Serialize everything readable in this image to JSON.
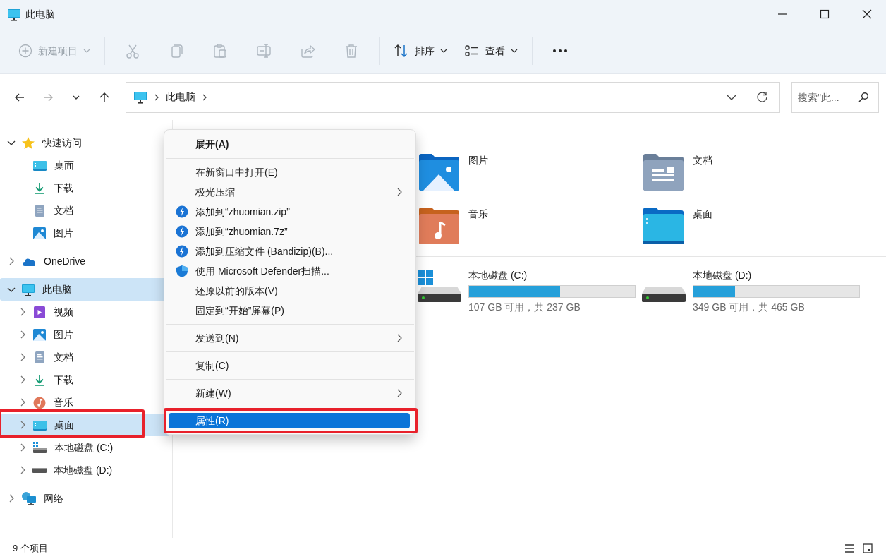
{
  "window": {
    "title": "此电脑"
  },
  "toolbar": {
    "new_button": {
      "label": "新建项目",
      "disabled": true
    },
    "actions": [
      {
        "kind": "cut",
        "disabled": true
      },
      {
        "kind": "copy",
        "disabled": true
      },
      {
        "kind": "paste",
        "disabled": true
      },
      {
        "kind": "rename",
        "disabled": true
      },
      {
        "kind": "share",
        "disabled": true
      },
      {
        "kind": "delete",
        "disabled": true
      }
    ],
    "sort": {
      "label": "排序"
    },
    "view": {
      "label": "查看"
    }
  },
  "address": {
    "path": [
      "此电脑"
    ],
    "search": {
      "placeholder": "搜索\"此..."
    }
  },
  "sidebar": {
    "items": [
      {
        "label": "快速访问",
        "kind": "star",
        "expanded": true,
        "selected": false,
        "children": [
          {
            "label": "桌面",
            "kind": "desktop",
            "selected": false
          },
          {
            "label": "下载",
            "kind": "download",
            "selected": false
          },
          {
            "label": "文档",
            "kind": "documents",
            "selected": false
          },
          {
            "label": "图片",
            "kind": "pictures",
            "selected": false
          }
        ]
      },
      {
        "label": "OneDrive",
        "kind": "cloud",
        "expanded": false,
        "selected": false
      },
      {
        "label": "此电脑",
        "kind": "pc",
        "expanded": true,
        "selected": true,
        "children": [
          {
            "label": "视频",
            "kind": "videos",
            "expanded": false,
            "selected": false
          },
          {
            "label": "图片",
            "kind": "pictures",
            "expanded": false,
            "selected": false
          },
          {
            "label": "文档",
            "kind": "documents",
            "expanded": false,
            "selected": false
          },
          {
            "label": "下载",
            "kind": "download",
            "expanded": false,
            "selected": false
          },
          {
            "label": "音乐",
            "kind": "music",
            "expanded": false,
            "selected": false
          },
          {
            "label": "桌面",
            "kind": "desktop",
            "expanded": false,
            "selected": true,
            "highlighted": true
          },
          {
            "label": "本地磁盘 (C:)",
            "kind": "systemdrive",
            "expanded": false,
            "selected": false
          },
          {
            "label": "本地磁盘 (D:)",
            "kind": "drive",
            "expanded": false,
            "selected": false
          }
        ]
      },
      {
        "label": "网络",
        "kind": "network",
        "expanded": false,
        "selected": false
      }
    ]
  },
  "folders": [
    {
      "label": "图片",
      "kind": "pictures"
    },
    {
      "label": "文档",
      "kind": "documents"
    },
    {
      "label": "音乐",
      "kind": "music"
    },
    {
      "label": "桌面",
      "kind": "desktop"
    }
  ],
  "drives": [
    {
      "label": "本地磁盘 (C:)",
      "kind": "systemdrive",
      "level": 0.549,
      "reading": "107 GB 可用，共 237 GB"
    },
    {
      "label": "本地磁盘 (D:)",
      "kind": "drive",
      "level": 0.249,
      "reading": "349 GB 可用，共 465 GB"
    }
  ],
  "context_menu": {
    "sections": [
      [
        {
          "label": "展开(A)",
          "default": true,
          "submenu": false,
          "selected": false
        }
      ],
      [
        {
          "label": "在新窗口中打开(E)",
          "submenu": false,
          "selected": false
        },
        {
          "label": "极光压缩",
          "submenu": true,
          "selected": false
        },
        {
          "label": "添加到“zhuomian.zip”",
          "kind": "bandizip",
          "submenu": false,
          "selected": false
        },
        {
          "label": "添加到“zhuomian.7z”",
          "kind": "bandizip",
          "submenu": false,
          "selected": false
        },
        {
          "label": "添加到压缩文件 (Bandizip)(B)...",
          "kind": "bandizip",
          "submenu": false,
          "selected": false
        },
        {
          "label": "使用 Microsoft Defender扫描...",
          "kind": "defender",
          "submenu": false,
          "selected": false
        },
        {
          "label": "还原以前的版本(V)",
          "submenu": false,
          "selected": false
        },
        {
          "label": "固定到“开始”屏幕(P)",
          "submenu": false,
          "selected": false
        }
      ],
      [
        {
          "label": "发送到(N)",
          "submenu": true,
          "selected": false
        }
      ],
      [
        {
          "label": "复制(C)",
          "submenu": false,
          "selected": false
        }
      ],
      [
        {
          "label": "新建(W)",
          "submenu": true,
          "selected": false
        }
      ],
      [
        {
          "label": "属性(R)",
          "submenu": false,
          "selected": true,
          "highlighted": true
        }
      ]
    ]
  },
  "status_bar": {
    "count": "9 个项目"
  }
}
